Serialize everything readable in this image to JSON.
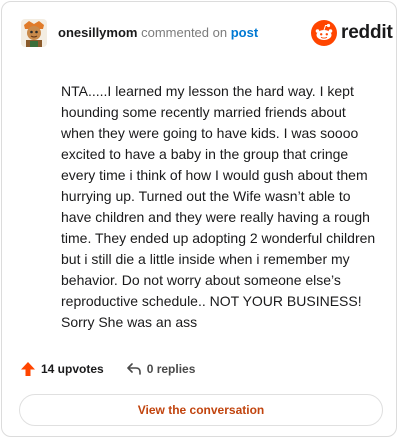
{
  "header": {
    "username": "onesillymom",
    "action": "commented on",
    "post_link": "post"
  },
  "brand": {
    "logo_text": "reddit",
    "logo_color": "#ff4500"
  },
  "comment": {
    "body": "NTA.....I learned my lesson the hard way. I kept hounding some recently married friends about when they were going to have kids. I was soooo excited to have a baby in the group that cringe every time i think of how I would gush about them hurrying up. Turned out the Wife wasn’t able to have children and they were really having a rough time. They ended up adopting 2 wonderful children but i still die a little inside when i remember my behavior. Do not worry about someone else’s reproductive schedule.. NOT YOUR BUSINESS! Sorry She was an ass"
  },
  "footer": {
    "upvotes": "14 upvotes",
    "replies": "0 replies",
    "upvote_icon": "upvote-arrow-icon",
    "reply_icon": "reply-arrow-icon"
  },
  "cta": {
    "label": "View the conversation",
    "color": "#c1440e"
  }
}
